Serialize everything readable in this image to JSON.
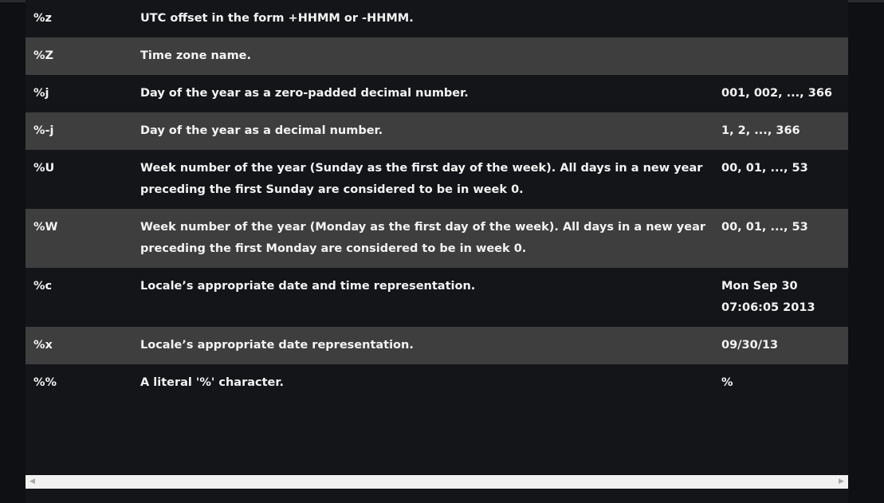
{
  "table": {
    "rows": [
      {
        "code": "%z",
        "description": "UTC offset in the form +HHMM or -HHMM.",
        "example": ""
      },
      {
        "code": "%Z",
        "description": "Time zone name.",
        "example": ""
      },
      {
        "code": "%j",
        "description": "Day of the year as a zero-padded decimal number.",
        "example": "001, 002, ..., 366"
      },
      {
        "code": "%-j",
        "description": "Day of the year as a decimal number.",
        "example": "1, 2, ..., 366"
      },
      {
        "code": "%U",
        "description": "Week number of the year (Sunday as the first day of the week). All days in a new year preceding the first Sunday are considered to be in week 0.",
        "example": "00, 01, ..., 53"
      },
      {
        "code": "%W",
        "description": "Week number of the year (Monday as the first day of the week). All days in a new year preceding the first Monday are considered to be in week 0.",
        "example": "00, 01, ..., 53"
      },
      {
        "code": "%c",
        "description": "Locale’s appropriate date and time representation.",
        "example": "Mon Sep 30 07:06:05 2013"
      },
      {
        "code": "%x",
        "description": "Locale’s appropriate date representation.",
        "example": "09/30/13"
      },
      {
        "code": "%%",
        "description": "A literal '%' character.",
        "example": "%"
      }
    ]
  },
  "scrollbar": {
    "left_icon": "left-arrow-icon",
    "right_icon": "right-arrow-icon"
  }
}
